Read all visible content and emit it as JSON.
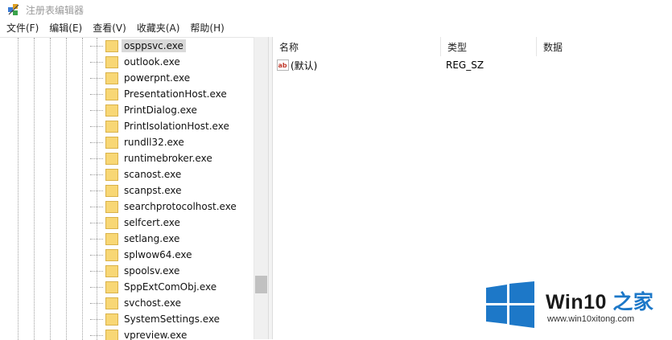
{
  "window": {
    "title": "注册表编辑器"
  },
  "menu": [
    {
      "label": "文件(F)"
    },
    {
      "label": "编辑(E)"
    },
    {
      "label": "查看(V)"
    },
    {
      "label": "收藏夹(A)"
    },
    {
      "label": "帮助(H)"
    }
  ],
  "tree": {
    "items": [
      {
        "label": "osppsvc.exe",
        "selected": true
      },
      {
        "label": "outlook.exe"
      },
      {
        "label": "powerpnt.exe"
      },
      {
        "label": "PresentationHost.exe"
      },
      {
        "label": "PrintDialog.exe"
      },
      {
        "label": "PrintIsolationHost.exe"
      },
      {
        "label": "rundll32.exe"
      },
      {
        "label": "runtimebroker.exe"
      },
      {
        "label": "scanost.exe"
      },
      {
        "label": "scanpst.exe"
      },
      {
        "label": "searchprotocolhost.exe"
      },
      {
        "label": "selfcert.exe"
      },
      {
        "label": "setlang.exe"
      },
      {
        "label": "splwow64.exe"
      },
      {
        "label": "spoolsv.exe"
      },
      {
        "label": "SppExtComObj.exe"
      },
      {
        "label": "svchost.exe"
      },
      {
        "label": "SystemSettings.exe"
      },
      {
        "label": "vpreview.exe"
      }
    ]
  },
  "list": {
    "columns": [
      {
        "label": "名称"
      },
      {
        "label": "类型"
      },
      {
        "label": "数据"
      }
    ],
    "rows": [
      {
        "icon": "string-value-icon",
        "name": "(默认)",
        "type": "REG_SZ",
        "data": ""
      }
    ]
  },
  "watermark": {
    "brand_prefix": "Win10 ",
    "brand_suffix": "之家",
    "url": "www.win10xitong.com",
    "colors": {
      "blue": "#1d78c8",
      "dark": "#1a1a1a"
    }
  },
  "colors": {
    "folder_yellow": "#f8d775",
    "selection_gray": "#d9d9d9",
    "scrollbar_thumb": "#c1c1c1"
  }
}
